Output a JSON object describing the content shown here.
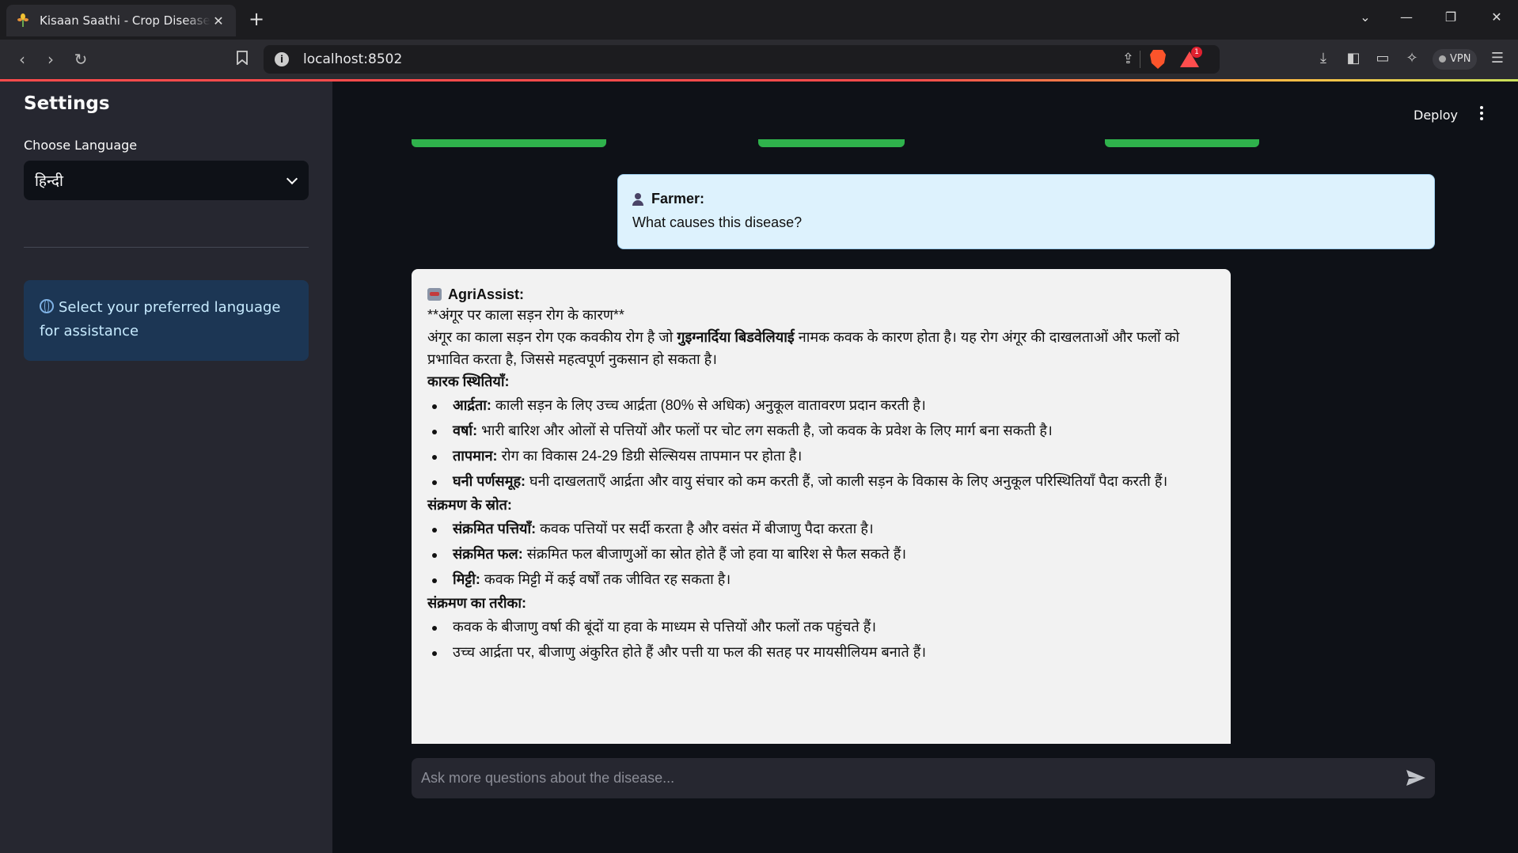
{
  "browser": {
    "tab_title": "Kisaan Saathi - Crop Disease Detection",
    "url": "localhost:8502",
    "notification_count": "1",
    "vpn_label": "VPN"
  },
  "app": {
    "deploy_label": "Deploy"
  },
  "sidebar": {
    "title": "Settings",
    "language_label": "Choose Language",
    "language_value": "हिन्दी",
    "info_text": "Select your preferred language for assistance"
  },
  "chat": {
    "user": {
      "name": "Farmer:",
      "message": "What causes this disease?"
    },
    "assistant": {
      "name": "AgriAssist:",
      "title_line": "**अंगूर पर काला सड़न रोग के कारण**",
      "intro_before": "अंगूर का काला सड़न रोग एक कवकीय रोग है जो ",
      "intro_bold": "गुइग्नार्दिया बिडवेलियाई",
      "intro_after": " नामक कवक के कारण होता है। यह रोग अंगूर की दाखलताओं और फलों को प्रभावित करता है, जिससे महत्वपूर्ण नुकसान हो सकता है।",
      "sections": [
        {
          "heading": "कारक स्थितियाँ:",
          "items": [
            {
              "term": "आर्द्रता:",
              "text": " काली सड़न के लिए उच्च आर्द्रता (80% से अधिक) अनुकूल वातावरण प्रदान करती है।"
            },
            {
              "term": "वर्षा:",
              "text": " भारी बारिश और ओलों से पत्तियों और फलों पर चोट लग सकती है, जो कवक के प्रवेश के लिए मार्ग बना सकती है।"
            },
            {
              "term": "तापमान:",
              "text": " रोग का विकास 24-29 डिग्री सेल्सियस तापमान पर होता है।"
            },
            {
              "term": "घनी पर्णसमूह:",
              "text": " घनी दाखलताएँ आर्द्रता और वायु संचार को कम करती हैं, जो काली सड़न के विकास के लिए अनुकूल परिस्थितियाँ पैदा करती हैं।"
            }
          ]
        },
        {
          "heading": "संक्रमण के स्रोत:",
          "items": [
            {
              "term": "संक्रमित पत्तियाँ:",
              "text": " कवक पत्तियों पर सर्दी करता है और वसंत में बीजाणु पैदा करता है।"
            },
            {
              "term": "संक्रमित फल:",
              "text": " संक्रमित फल बीजाणुओं का स्रोत होते हैं जो हवा या बारिश से फैल सकते हैं।"
            },
            {
              "term": "मिट्टी:",
              "text": " कवक मिट्टी में कई वर्षों तक जीवित रह सकता है।"
            }
          ]
        },
        {
          "heading": "संक्रमण का तरीका:",
          "items": [
            {
              "term": "",
              "text": "कवक के बीजाणु वर्षा की बूंदों या हवा के माध्यम से पत्तियों और फलों तक पहुंचते हैं।"
            },
            {
              "term": "",
              "text": "उच्च आर्द्रता पर, बीजाणु अंकुरित होते हैं और पत्ती या फल की सतह पर मायसीलियम बनाते हैं।"
            }
          ]
        }
      ]
    },
    "input_placeholder": "Ask more questions about the disease..."
  },
  "colors": {
    "app_bg": "#0e1117",
    "sidebar_bg": "#262730",
    "progress_green": "#2fb24c",
    "user_bubble": "#ddf2fd",
    "assistant_bubble": "#f2f2f2",
    "info_box": "#1c3654"
  }
}
